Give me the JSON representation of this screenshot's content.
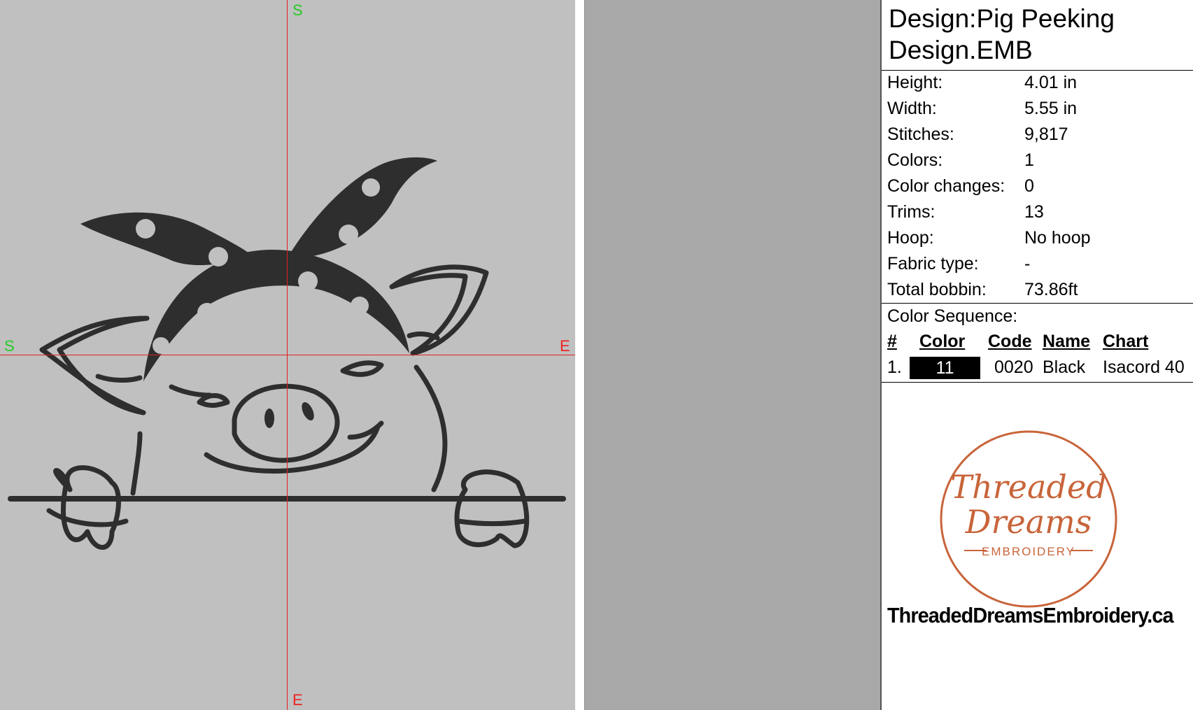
{
  "canvas": {
    "axis_labels": {
      "top": "S",
      "left": "S",
      "right": "E",
      "bottom": "E"
    }
  },
  "info": {
    "title_line1": "Design:Pig Peeking",
    "title_line2": "Design.EMB",
    "stats": [
      {
        "label": "Height:",
        "value": "4.01 in"
      },
      {
        "label": "Width:",
        "value": "5.55 in"
      },
      {
        "label": "Stitches:",
        "value": "9,817"
      },
      {
        "label": "Colors:",
        "value": "1"
      },
      {
        "label": "Color changes:",
        "value": "0"
      },
      {
        "label": "Trims:",
        "value": "13"
      },
      {
        "label": "Hoop:",
        "value": "No hoop"
      },
      {
        "label": "Fabric type:",
        "value": "-"
      },
      {
        "label": "Total bobbin:",
        "value": "73.86ft"
      }
    ],
    "color_sequence_title": "Color Sequence:",
    "columns": {
      "num": "#",
      "color": "Color",
      "code": "Code",
      "name": "Name",
      "chart": "Chart"
    },
    "rows": [
      {
        "num": "1.",
        "color": "11",
        "swatch": "#000000",
        "code": "0020",
        "name": "Black",
        "chart": "Isacord 40"
      }
    ]
  },
  "logo": {
    "line1": "Threaded",
    "line2": "Dreams",
    "line3": "EMBROIDERY",
    "color": "#c8643a"
  },
  "website": "ThreadedDreamsEmbroidery.ca"
}
